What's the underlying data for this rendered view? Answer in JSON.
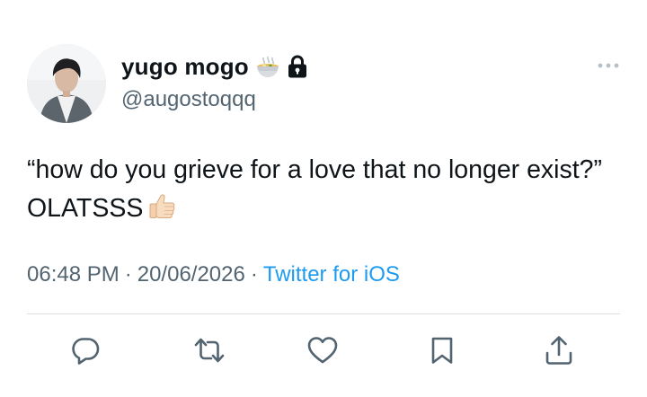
{
  "tweet": {
    "display_name": "yugo mogo",
    "handle": "@augostoqqq",
    "text": "“how do you grieve for a love that no longer exist?” OLATSSS",
    "time": "06:48 PM",
    "separator": "·",
    "date": "20/06/2026",
    "source": "Twitter for iOS",
    "name_emoji_icon": "ramen-bowl-icon",
    "protected_icon": "lock-icon",
    "text_emoji_icon": "thumbs-up-icon"
  },
  "actions": [
    {
      "icon": "reply-icon"
    },
    {
      "icon": "retweet-icon"
    },
    {
      "icon": "like-icon"
    },
    {
      "icon": "bookmark-icon"
    },
    {
      "icon": "share-icon"
    }
  ],
  "colors": {
    "text_primary": "#0f1419",
    "text_secondary": "#536471",
    "link": "#1d9bf0",
    "divider": "#d9dee2"
  }
}
